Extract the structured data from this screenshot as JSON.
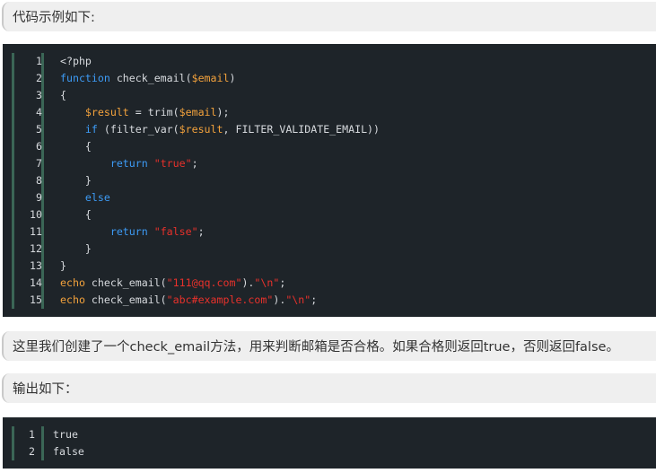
{
  "note1": "代码示例如下:",
  "code_lines": [
    [
      {
        "t": "<?php",
        "c": ""
      }
    ],
    [
      {
        "t": "function",
        "c": "kw"
      },
      {
        "t": " check_email(",
        "c": ""
      },
      {
        "t": "$email",
        "c": "var"
      },
      {
        "t": ")",
        "c": ""
      }
    ],
    [
      {
        "t": "{",
        "c": ""
      }
    ],
    [
      {
        "t": "    ",
        "c": ""
      },
      {
        "t": "$result",
        "c": "var"
      },
      {
        "t": " = trim(",
        "c": ""
      },
      {
        "t": "$email",
        "c": "var"
      },
      {
        "t": ");",
        "c": ""
      }
    ],
    [
      {
        "t": "    ",
        "c": ""
      },
      {
        "t": "if",
        "c": "kw"
      },
      {
        "t": " (filter_var(",
        "c": ""
      },
      {
        "t": "$result",
        "c": "var"
      },
      {
        "t": ", FILTER_VALIDATE_EMAIL))",
        "c": ""
      }
    ],
    [
      {
        "t": "    {",
        "c": ""
      }
    ],
    [
      {
        "t": "        ",
        "c": ""
      },
      {
        "t": "return",
        "c": "kw"
      },
      {
        "t": " ",
        "c": ""
      },
      {
        "t": "\"true\"",
        "c": "str"
      },
      {
        "t": ";",
        "c": ""
      }
    ],
    [
      {
        "t": "    }",
        "c": ""
      }
    ],
    [
      {
        "t": "    ",
        "c": ""
      },
      {
        "t": "else",
        "c": "kw"
      }
    ],
    [
      {
        "t": "    {",
        "c": ""
      }
    ],
    [
      {
        "t": "        ",
        "c": ""
      },
      {
        "t": "return",
        "c": "kw"
      },
      {
        "t": " ",
        "c": ""
      },
      {
        "t": "\"false\"",
        "c": "str"
      },
      {
        "t": ";",
        "c": ""
      }
    ],
    [
      {
        "t": "    }",
        "c": ""
      }
    ],
    [
      {
        "t": "}",
        "c": ""
      }
    ],
    [
      {
        "t": "echo",
        "c": "var"
      },
      {
        "t": " check_email(",
        "c": ""
      },
      {
        "t": "\"111@qq.com\"",
        "c": "str"
      },
      {
        "t": ").",
        "c": ""
      },
      {
        "t": "\"\\n\"",
        "c": "str"
      },
      {
        "t": ";",
        "c": ""
      }
    ],
    [
      {
        "t": "echo",
        "c": "var"
      },
      {
        "t": " check_email(",
        "c": ""
      },
      {
        "t": "\"abc#example.com\"",
        "c": "str"
      },
      {
        "t": ").",
        "c": ""
      },
      {
        "t": "\"\\n\"",
        "c": "str"
      },
      {
        "t": ";",
        "c": ""
      }
    ]
  ],
  "note2": "这里我们创建了一个check_email方法，用来判断邮箱是否合格。如果合格则返回true，否则返回false。",
  "note3": "输出如下：",
  "output_lines": [
    "true",
    "false"
  ],
  "colors": {
    "keyword": "#3d9bf5",
    "variable": "#f3a23c",
    "string": "#e8312b",
    "code_bg": "#1e2429",
    "gutter_bar": "#3b6656"
  }
}
